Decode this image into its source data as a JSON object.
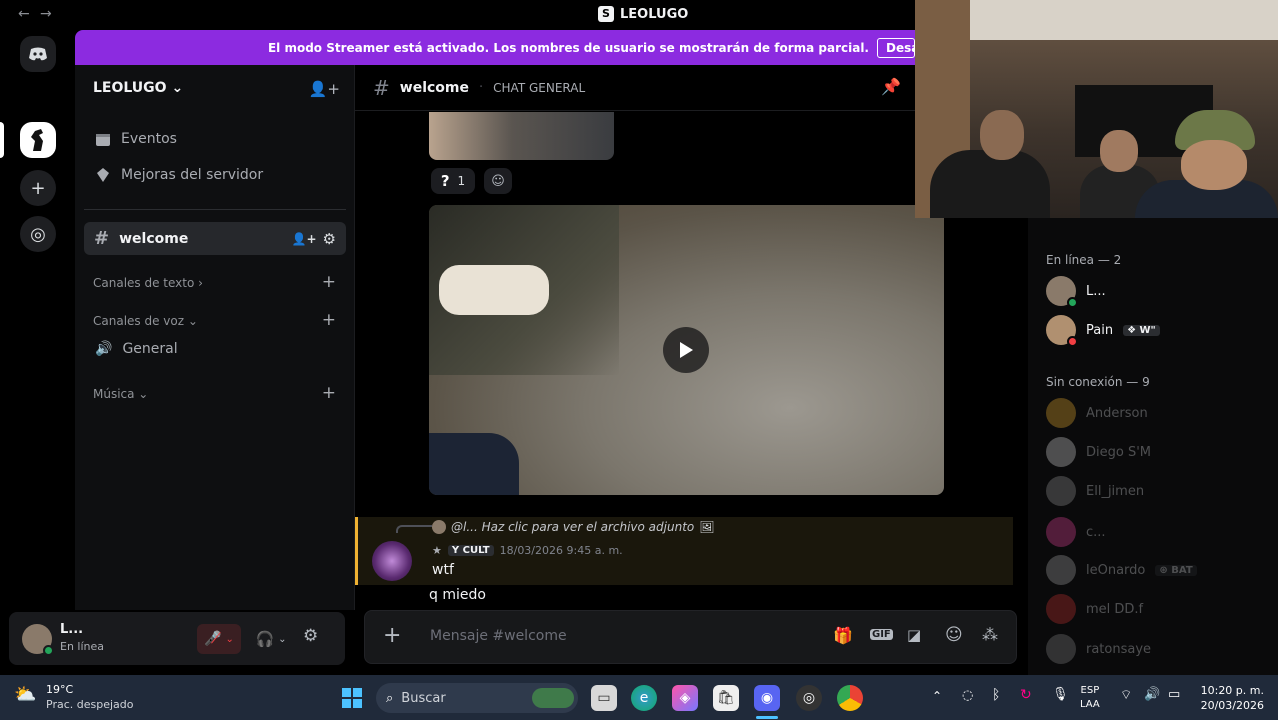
{
  "window": {
    "title": "LEOLUGO"
  },
  "banner": {
    "text": "El modo Streamer está activado. Los nombres de usuario se mostrarán de forma parcial.",
    "button": "Desa"
  },
  "server": {
    "name": "LEOLUGO",
    "menu": [
      {
        "label": "Eventos",
        "icon": "calendar-icon"
      },
      {
        "label": "Mejoras del servidor",
        "icon": "boost-icon"
      }
    ],
    "active_channel": "welcome",
    "categories": [
      {
        "label": "Canales de texto ›"
      },
      {
        "label": "Canales de voz ⌄"
      },
      {
        "label": "Música ⌄"
      }
    ],
    "voice_channels": [
      "General"
    ]
  },
  "user": {
    "name": "L...",
    "status": "En línea"
  },
  "chat": {
    "channel": "welcome",
    "topic": "CHAT GENERAL",
    "reaction_count": "1",
    "reply_preview": "@l... Haz clic para ver el archivo adjunto",
    "message_tag": "CULT",
    "message_time": "18/03/2026 9:45 a. m.",
    "messages": [
      "wtf",
      "q miedo"
    ],
    "input_placeholder": "Mensaje #welcome"
  },
  "members": {
    "online_header": "En línea — 2",
    "online": [
      {
        "name": "L...",
        "badge": ""
      },
      {
        "name": "Pain",
        "badge": "W\""
      }
    ],
    "offline_header": "Sin conexión — 9",
    "offline": [
      {
        "name": "Anderson",
        "badge": ""
      },
      {
        "name": "Diego S'M",
        "badge": ""
      },
      {
        "name": "Ell_jimen",
        "badge": ""
      },
      {
        "name": "c...",
        "badge": ""
      },
      {
        "name": "leOnardo",
        "badge": "BAT"
      },
      {
        "name": "mel DD.f",
        "badge": ""
      },
      {
        "name": "ratonsaye",
        "badge": ""
      }
    ]
  },
  "taskbar": {
    "weather_temp": "19°C",
    "weather_desc": "Prac. despejado",
    "search": "Buscar",
    "lang": "ESP",
    "lang2": "LAA",
    "time": "10:20 p. m.",
    "date": "20/03/2026"
  },
  "colors": {
    "accent": "#8c2be0",
    "online": "#23a55a",
    "dnd": "#f23f43",
    "reply_bg": "#2a2410",
    "reply_bar": "#f0b232"
  }
}
